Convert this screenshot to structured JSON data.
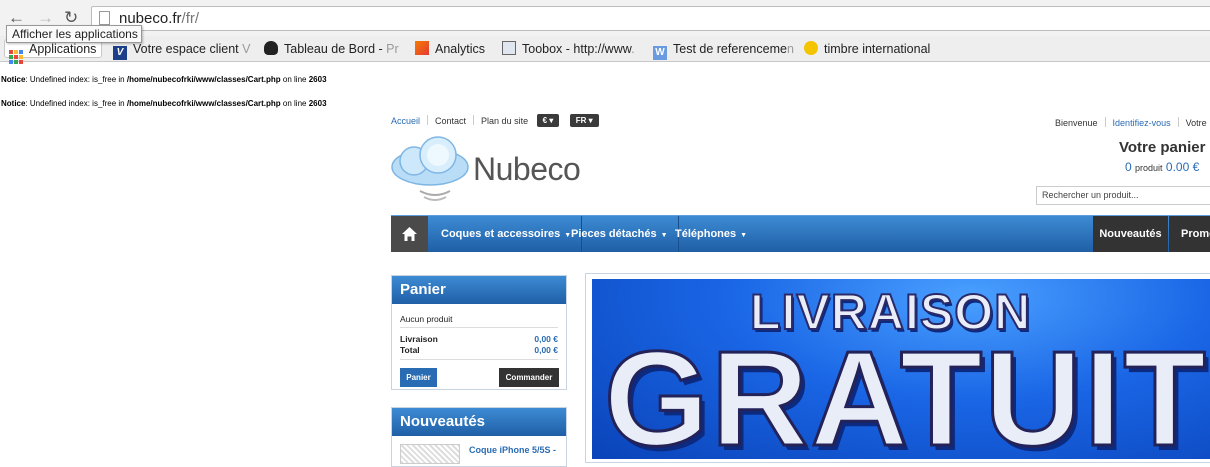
{
  "browser": {
    "url_host": "nubeco.fr",
    "url_path": "/fr/",
    "tooltip": "Afficher les applications",
    "bookmarks": [
      {
        "label": "Applications",
        "fade": ""
      },
      {
        "label": "Votre espace client ",
        "fade": "V"
      },
      {
        "label": "Tableau de Bord - ",
        "fade": "Pr"
      },
      {
        "label": "Analytics",
        "fade": ""
      },
      {
        "label": "Toobox - http://www",
        "fade": "."
      },
      {
        "label": "Test de referenceme",
        "fade": "n"
      },
      {
        "label": "timbre international",
        "fade": ""
      }
    ]
  },
  "notices": [
    {
      "label": "Notice",
      "text": ": Undefined index: is_free in ",
      "file": "/home/nubecofrki/www/classes/Cart.php",
      "on": " on line ",
      "line": "2603"
    },
    {
      "label": "Notice",
      "text": ": Undefined index: is_free in ",
      "file": "/home/nubecofrki/www/classes/Cart.php",
      "on": " on line ",
      "line": "2603"
    }
  ],
  "header": {
    "links": [
      "Accueil",
      "Contact",
      "Plan du site"
    ],
    "currency": "€ ▾",
    "language": "FR ▾",
    "welcome": "Bienvenue",
    "login": "Identifiez-vous",
    "your": "Votre",
    "logo": "Nubeco",
    "cart_title": "Votre panier",
    "cart_count": "0",
    "cart_count_label": "produit",
    "cart_total": "0.00 €",
    "search_placeholder": "Rechercher un produit..."
  },
  "menu": {
    "items": [
      "Coques et accessoires",
      "Pieces détachés",
      "Téléphones"
    ],
    "new": "Nouveautés",
    "promo": "Promo"
  },
  "panier_block": {
    "title": "Panier",
    "empty": "Aucun produit",
    "shipping_label": "Livraison",
    "shipping_value": "0,00 €",
    "total_label": "Total",
    "total_value": "0,00 €",
    "btn_panier": "Panier",
    "btn_commander": "Commander"
  },
  "nouveautes_block": {
    "title": "Nouveautés",
    "item": "Coque iPhone 5/5S -"
  },
  "banner": {
    "line1": "LIVRAISON",
    "line2": "GRATUITE"
  }
}
